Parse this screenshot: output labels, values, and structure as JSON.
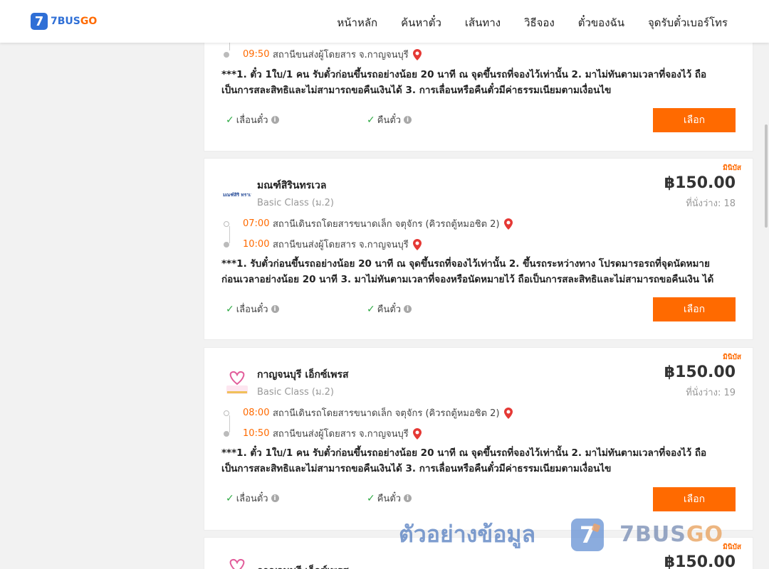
{
  "header": {
    "logo_mark": "7",
    "logo_text_a": "7BUS",
    "logo_text_b": "GO",
    "nav": [
      "หน้าหลัก",
      "ค้นหาตั๋ว",
      "เส้นทาง",
      "วิธีจอง",
      "ตั๋วของฉัน",
      "จุดรับตั๋วเบอร์โทร"
    ]
  },
  "common": {
    "change_label": "เลื่อนตั๋ว",
    "refund_label": "คืนตั๋ว",
    "select_label": "เลือก",
    "info_glyph": "i",
    "check_glyph": "✓"
  },
  "card0": {
    "arrive_time": "09:50",
    "arrive_stop": "สถานีขนส่งผู้โดยสาร จ.กาญจนบุรี",
    "policy": "***1. ตั๋ว 1ใบ/1 คน รับตั๋วก่อนขึ้นรถอย่างน้อย 20 นาที ณ จุดขึ้นรถที่จองไว้เท่านั้น 2. มาไม่ทันตามเวลาที่จองไว้ ถือเป็นการสละสิทธิและไม่สามารถขอคืนเงินได้ 3. การเลื่อนหรือคืนตั๋วมีค่าธรรมเนียมตามเงื่อนไข"
  },
  "card1": {
    "type": "มินิบัส",
    "operator": "มณฑ์สิรินทรเวล",
    "class": "Basic Class (ม.2)",
    "price": "฿150.00",
    "seats": "ที่นั่งว่าง: 18",
    "depart_time": "07:00",
    "depart_stop": "สถานีเดินรถโดยสารขนาดเล็ก จตุจักร (คิวรถตู้หมอชิต 2)",
    "arrive_time": "10:00",
    "arrive_stop": "สถานีขนส่งผู้โดยสาร จ.กาญจนบุรี",
    "policy": "***1. รับตั๋วก่อนขึ้นรถอย่างน้อย 20 นาที ณ จุดขึ้นรถที่จองไว้เท่านั้น 2. ขึ้นรถระหว่างทาง โปรดมารอรถที่จุดนัดหมายก่อนเวลาอย่างน้อย 20 นาที 3. มาไม่ทันตามเวลาที่จองหรือนัดหมายไว้ ถือเป็นการสละสิทธิและไม่สามารถขอคืนเงิน ได้"
  },
  "card2": {
    "type": "มินิบัส",
    "operator": "กาญจนบุรี เอ็กซ์เพรส",
    "class": "Basic Class (ม.2)",
    "price": "฿150.00",
    "seats": "ที่นั่งว่าง: 19",
    "depart_time": "08:00",
    "depart_stop": "สถานีเดินรถโดยสารขนาดเล็ก จตุจักร (คิวรถตู้หมอชิต 2)",
    "arrive_time": "10:50",
    "arrive_stop": "สถานีขนส่งผู้โดยสาร จ.กาญจนบุรี",
    "policy": "***1. ตั๋ว 1ใบ/1 คน รับตั๋วก่อนขึ้นรถอย่างน้อย 20 นาที ณ จุดขึ้นรถที่จองไว้เท่านั้น 2. มาไม่ทันตามเวลาที่จองไว้ ถือเป็นการสละสิทธิและไม่สามารถขอคืนเงินได้ 3. การเลื่อนหรือคืนตั๋วมีค่าธรรมเนียมตามเงื่อนไข"
  },
  "card3": {
    "type": "มินิบัส",
    "operator": "กาญจนบุรี เอ็กซ์เพรส",
    "price": "฿150.00"
  },
  "watermark": {
    "text": "ตัวอย่างข้อมูล",
    "mark": "7",
    "brand_a": "7BUS",
    "brand_b": "GO"
  },
  "colors": {
    "accent": "#ff6a00",
    "brand": "#2f6fd6",
    "check": "#2eaa44"
  }
}
